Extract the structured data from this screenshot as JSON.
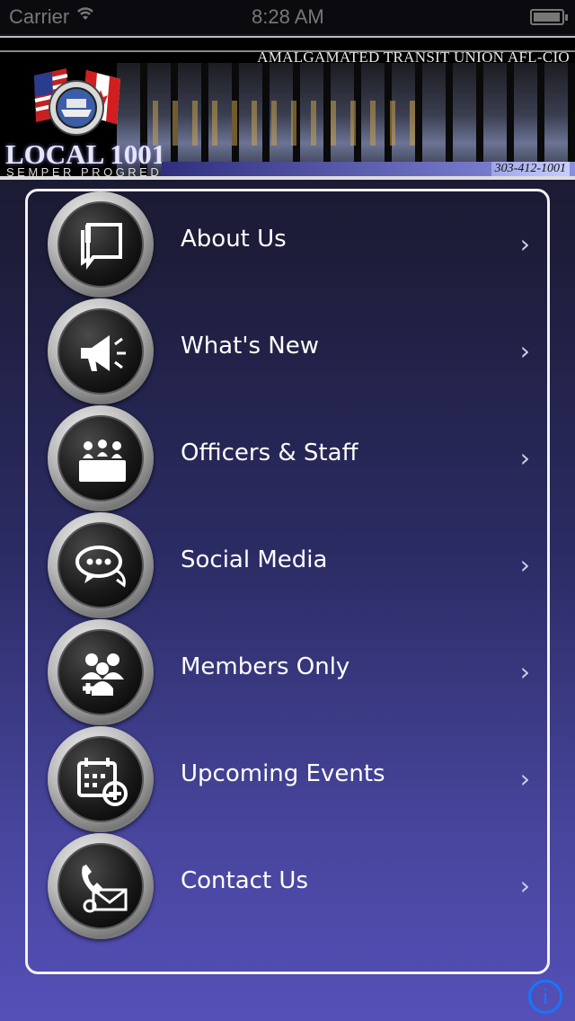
{
  "status_bar": {
    "carrier": "Carrier",
    "time": "8:28 AM",
    "battery_level": 0.95
  },
  "header": {
    "title": "AMALGAMATED TRANSIT UNION AFL-CIO",
    "local": "LOCAL 1001",
    "motto": "SEMPER PROGREDI",
    "phone": "303-412-1001"
  },
  "menu": {
    "items": [
      {
        "label": "About Us",
        "icon": "book-icon"
      },
      {
        "label": "What's New",
        "icon": "megaphone-icon"
      },
      {
        "label": "Officers & Staff",
        "icon": "officers-icon"
      },
      {
        "label": "Social Media",
        "icon": "chat-bubbles-icon"
      },
      {
        "label": "Members Only",
        "icon": "members-icon"
      },
      {
        "label": "Upcoming Events",
        "icon": "calendar-icon"
      },
      {
        "label": "Contact Us",
        "icon": "contact-icon"
      }
    ],
    "chevron": "›"
  },
  "info_button": {
    "label": "i"
  },
  "colors": {
    "info_blue": "#1677ff",
    "panel_border": "#f2f2f2"
  }
}
